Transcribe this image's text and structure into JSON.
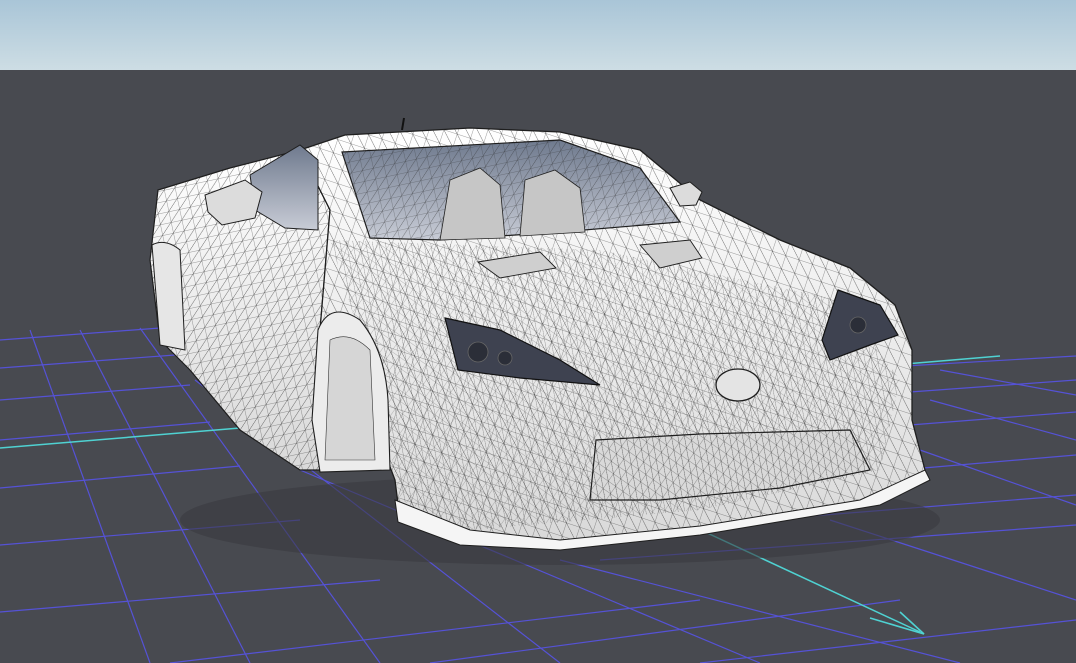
{
  "viewport": {
    "view_mode": "wireframe-on-shaded",
    "sky_top_color": "#a8c4d6",
    "sky_bottom_color": "#c9dbe3",
    "ground_color": "#484a50",
    "grid_color": "#5552d6",
    "axis_color": "#4fd2d2",
    "model_fill_color": "#f2f2f2",
    "wire_color": "#1e1e1e",
    "glass_color": "#9aa6b8"
  },
  "icons": {
    "axis_arrow": "axis-arrow-icon"
  }
}
